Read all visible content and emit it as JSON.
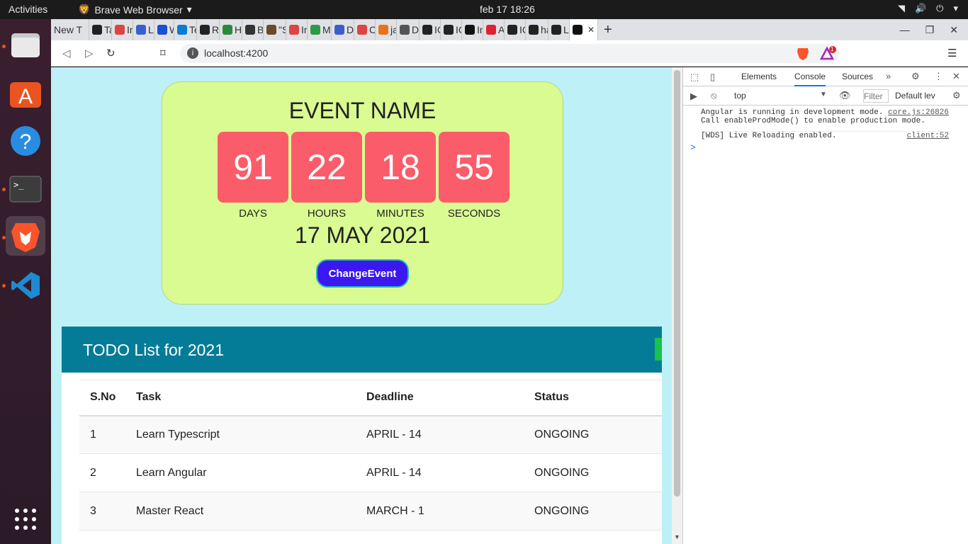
{
  "os": {
    "activities": "Activities",
    "app_name": "Brave Web Browser",
    "clock": "feb 17  18:26"
  },
  "browser": {
    "tabs": [
      "New T",
      "Ta",
      "In",
      "Le",
      "W",
      "Te",
      "Ra",
      "H",
      "Ba",
      "\"S",
      "In",
      "My",
      "Da",
      "Ca",
      "ja",
      "Do",
      "IC",
      "IC",
      "In",
      "An",
      "IC",
      "ha",
      "La",
      ""
    ],
    "url": "localhost:4200",
    "shield_count": "1"
  },
  "event": {
    "name": "EVENT NAME",
    "countdown": [
      {
        "value": "91",
        "unit": "DAYS"
      },
      {
        "value": "22",
        "unit": "HOURS"
      },
      {
        "value": "18",
        "unit": "MINUTES"
      },
      {
        "value": "55",
        "unit": "SECONDS"
      }
    ],
    "date": "17 MAY 2021",
    "change_button": "ChangeEvent"
  },
  "todo": {
    "title": "TODO List for 2021",
    "columns": [
      "S.No",
      "Task",
      "Deadline",
      "Status"
    ],
    "rows": [
      {
        "sno": "1",
        "task": "Learn Typescript",
        "deadline": "APRIL - 14",
        "status": "ONGOING"
      },
      {
        "sno": "2",
        "task": "Learn Angular",
        "deadline": "APRIL - 14",
        "status": "ONGOING"
      },
      {
        "sno": "3",
        "task": "Master React",
        "deadline": "MARCH - 1",
        "status": "ONGOING"
      }
    ]
  },
  "devtools": {
    "tabs": [
      "Elements",
      "Console",
      "Sources"
    ],
    "context": "top",
    "filter_placeholder": "Filter",
    "level": "Default lev",
    "logs": [
      {
        "line1": "Angular is running in development mode.",
        "line2": "Call enableProdMode() to enable production mode.",
        "source": "core.js:26826"
      },
      {
        "line1": "[WDS] Live Reloading enabled.",
        "line2": "",
        "source": "client:52"
      }
    ],
    "prompt": ">"
  }
}
